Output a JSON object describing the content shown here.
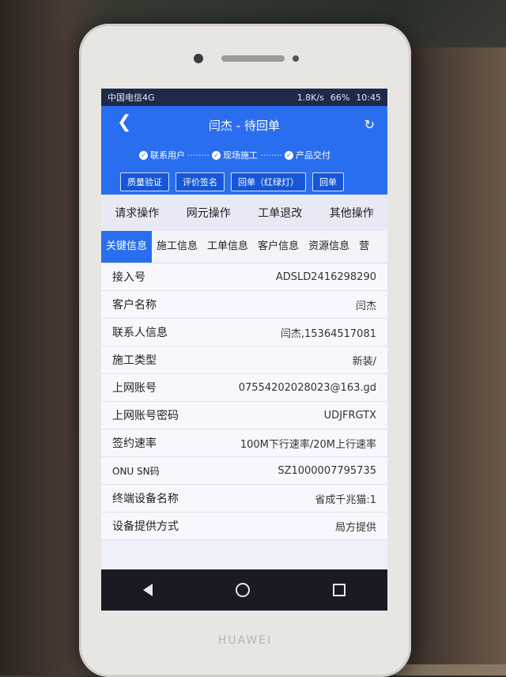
{
  "statusbar": {
    "carrier": "中国电信4G",
    "speed": "1.8K/s",
    "battery": "66%",
    "time": "10:45"
  },
  "header": {
    "title": "闫杰 - 待回单",
    "steps": [
      "联系用户",
      "现场施工",
      "产品交付"
    ],
    "buttons": [
      "质量验证",
      "评价签名",
      "回单（红绿灯）",
      "回单"
    ]
  },
  "actions": [
    "请求操作",
    "网元操作",
    "工单退改",
    "其他操作"
  ],
  "tabs": [
    "关键信息",
    "施工信息",
    "工单信息",
    "客户信息",
    "资源信息",
    "营"
  ],
  "info_rows": [
    {
      "label": "接入号",
      "value": "ADSLD2416298290"
    },
    {
      "label": "客户名称",
      "value": "闫杰"
    },
    {
      "label": "联系人信息",
      "value": "闫杰,15364517081"
    },
    {
      "label": "施工类型",
      "value": "新装/"
    },
    {
      "label": "上网账号",
      "value": "07554202028023@163.gd"
    },
    {
      "label": "上网账号密码",
      "value": "UDJFRGTX"
    },
    {
      "label": "签约速率",
      "value": "100M下行速率/20M上行速率"
    },
    {
      "label": "ONU SN码",
      "value": "SZ1000007795735"
    },
    {
      "label": "终端设备名称",
      "value": "省成千兆猫:1"
    },
    {
      "label": "设备提供方式",
      "value": "局方提供"
    }
  ],
  "brand": "HUAWEI"
}
